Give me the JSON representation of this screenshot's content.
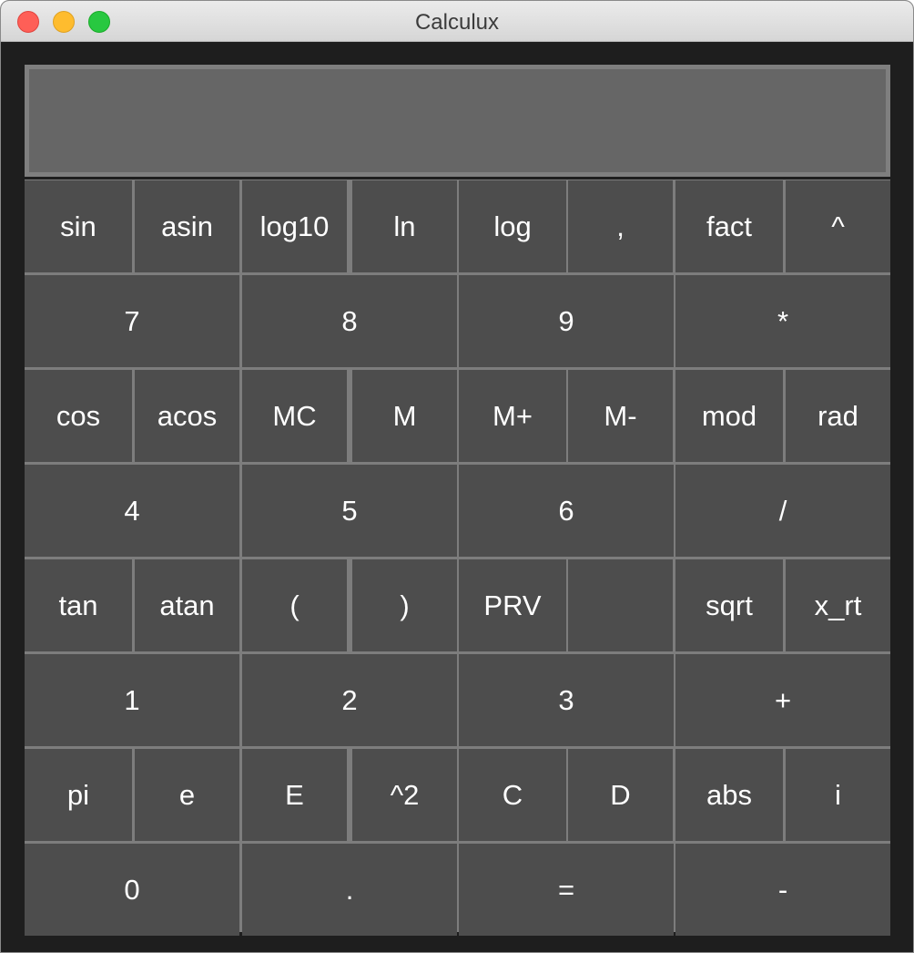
{
  "window": {
    "title": "Calculux"
  },
  "display": {
    "value": ""
  },
  "colors": {
    "window_bg": "#1e1e1e",
    "button_bg": "#4d4d4d",
    "button_text": "#ffffff",
    "grid_lines": "#7d7d7d",
    "display_bg": "#666666",
    "display_border": "#7f7f7f",
    "traffic_close": "#fe5f57",
    "traffic_minimize": "#febc2e",
    "traffic_zoom": "#28c840"
  },
  "keypad": {
    "rows": [
      {
        "buttons": [
          {
            "label": "sin",
            "name": "sin"
          },
          {
            "label": "asin",
            "name": "asin"
          },
          {
            "label": "log10",
            "name": "log10"
          },
          {
            "label": "ln",
            "name": "ln"
          },
          {
            "label": "log",
            "name": "log"
          },
          {
            "label": ",",
            "name": "comma"
          },
          {
            "label": "fact",
            "name": "fact"
          },
          {
            "label": "^",
            "name": "power"
          }
        ]
      },
      {
        "buttons": [
          {
            "label": "7",
            "name": "digit-7"
          },
          {
            "label": "8",
            "name": "digit-8"
          },
          {
            "label": "9",
            "name": "digit-9"
          },
          {
            "label": "*",
            "name": "multiply"
          }
        ]
      },
      {
        "buttons": [
          {
            "label": "cos",
            "name": "cos"
          },
          {
            "label": "acos",
            "name": "acos"
          },
          {
            "label": "MC",
            "name": "memory-clear"
          },
          {
            "label": "M",
            "name": "memory"
          },
          {
            "label": "M+",
            "name": "memory-add"
          },
          {
            "label": "M-",
            "name": "memory-subtract"
          },
          {
            "label": "mod",
            "name": "mod"
          },
          {
            "label": "rad",
            "name": "rad"
          }
        ]
      },
      {
        "buttons": [
          {
            "label": "4",
            "name": "digit-4"
          },
          {
            "label": "5",
            "name": "digit-5"
          },
          {
            "label": "6",
            "name": "digit-6"
          },
          {
            "label": "/",
            "name": "divide"
          }
        ]
      },
      {
        "buttons": [
          {
            "label": "tan",
            "name": "tan"
          },
          {
            "label": "atan",
            "name": "atan"
          },
          {
            "label": "(",
            "name": "open-paren"
          },
          {
            "label": ")",
            "name": "close-paren"
          },
          {
            "label": "PRV",
            "name": "previous"
          },
          {
            "label": "",
            "name": "blank"
          },
          {
            "label": "sqrt",
            "name": "sqrt"
          },
          {
            "label": "x_rt",
            "name": "x-root"
          }
        ]
      },
      {
        "buttons": [
          {
            "label": "1",
            "name": "digit-1"
          },
          {
            "label": "2",
            "name": "digit-2"
          },
          {
            "label": "3",
            "name": "digit-3"
          },
          {
            "label": "+",
            "name": "plus"
          }
        ]
      },
      {
        "buttons": [
          {
            "label": "pi",
            "name": "pi"
          },
          {
            "label": "e",
            "name": "euler-e"
          },
          {
            "label": "E",
            "name": "exponent-e"
          },
          {
            "label": "^2",
            "name": "square"
          },
          {
            "label": "C",
            "name": "clear"
          },
          {
            "label": "D",
            "name": "delete"
          },
          {
            "label": "abs",
            "name": "abs"
          },
          {
            "label": "i",
            "name": "imaginary"
          }
        ]
      },
      {
        "buttons": [
          {
            "label": "0",
            "name": "digit-0"
          },
          {
            "label": ".",
            "name": "decimal-point"
          },
          {
            "label": "=",
            "name": "equals"
          },
          {
            "label": "-",
            "name": "minus"
          }
        ]
      }
    ]
  }
}
